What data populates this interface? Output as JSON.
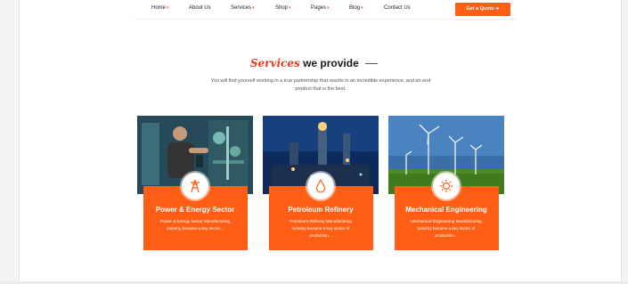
{
  "nav": {
    "items": [
      {
        "label": "Home",
        "caret": true
      },
      {
        "label": "About Us",
        "caret": false
      },
      {
        "label": "Services",
        "caret": true
      },
      {
        "label": "Shop",
        "caret": true
      },
      {
        "label": "Pages",
        "caret": true
      },
      {
        "label": "Blog",
        "caret": true
      },
      {
        "label": "Contact Us",
        "caret": false
      }
    ],
    "caret_glyph": "▾",
    "quote_button": "Get a Quote ➜"
  },
  "section": {
    "accent_word": "Services",
    "heading_rest": "we provide",
    "subtitle": "You will find yourself working in a true partnership that results in an incredible experience, and an end product that is the best."
  },
  "cards": [
    {
      "title": "Power & Energy Sector",
      "description": "Power & Energy Sector Manufacturing industry became a key sector...",
      "icon": "power-tower-icon"
    },
    {
      "title": "Petroleum Refinery",
      "description": "Petroleum Refinery Manufacturing industry became a key sector of production...",
      "icon": "oil-drop-icon"
    },
    {
      "title": "Mechanical Engineering",
      "description": "Mechanical Engineering Manufacturing industry became a key sector of production...",
      "icon": "gear-icon"
    }
  ],
  "colors": {
    "accent": "#ff5e14",
    "heading_accent": "#e63c1c",
    "text_dark": "#1a1a1a"
  }
}
